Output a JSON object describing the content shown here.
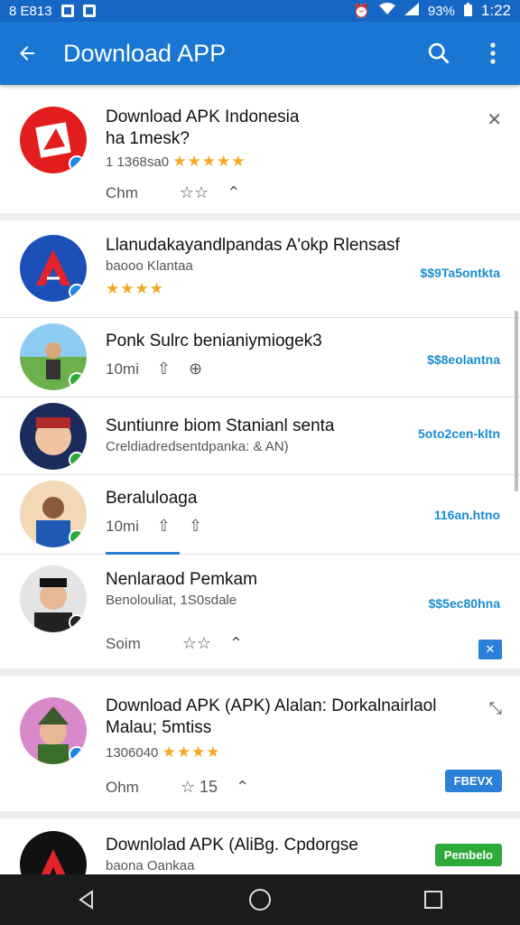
{
  "status_bar": {
    "left_text": "8 E813",
    "battery": "93%",
    "time": "1:22"
  },
  "app_bar": {
    "title": "Download APP",
    "back_icon": "arrow-left-icon",
    "search_icon": "search-icon",
    "more_icon": "more-vert-icon"
  },
  "cards": [
    {
      "title": "Download APK Indonesia",
      "subtitle": "ha 1mesk?",
      "meta": "1 1368sa0",
      "stars": "★★★★★",
      "action_label": "Chm"
    },
    {
      "title": "Llanudakayandlpandas A'okp Rlensasf",
      "subtitle": "baooo Klantaa",
      "stars": "★★★★",
      "price": "$$9Ta5ontkta"
    },
    {
      "title": "Ponk Sulrc benianiymiogek3",
      "subtitle": "10mi",
      "price": "$$8eolantna"
    },
    {
      "title": "Suntiunre biom Stanianl senta",
      "subtitle": "Creldiadredsentdpanka: & AN)",
      "price": "5oto2cen-kltn"
    },
    {
      "title": "Beraluloaga",
      "subtitle": "10mi",
      "price": "116an.htno"
    },
    {
      "title": "Nenlaraod Pemkam",
      "subtitle": "Benolouliat, 1S0sdale",
      "price": "$$5ec80hna",
      "action_label": "Soim"
    },
    {
      "title": "Download APK (APK) Alalan: Dorkalnairlaol",
      "subtitle": "Malau; 5mtiss",
      "meta": "1306040",
      "stars": "★★★★",
      "action_label": "Ohm",
      "count": "15",
      "button_label": "FBEVX"
    },
    {
      "title": "Downlolad APK (AliBg. Cpdorgse",
      "subtitle": "baona Oankaa",
      "button_label": "Pembelo"
    }
  ],
  "colors": {
    "primary": "#1976d2",
    "status_bar": "#1666c5",
    "price": "#1a8bd0",
    "star": "#f5a623",
    "green_button": "#2eaa3a",
    "blue_button": "#2a7fd6"
  }
}
